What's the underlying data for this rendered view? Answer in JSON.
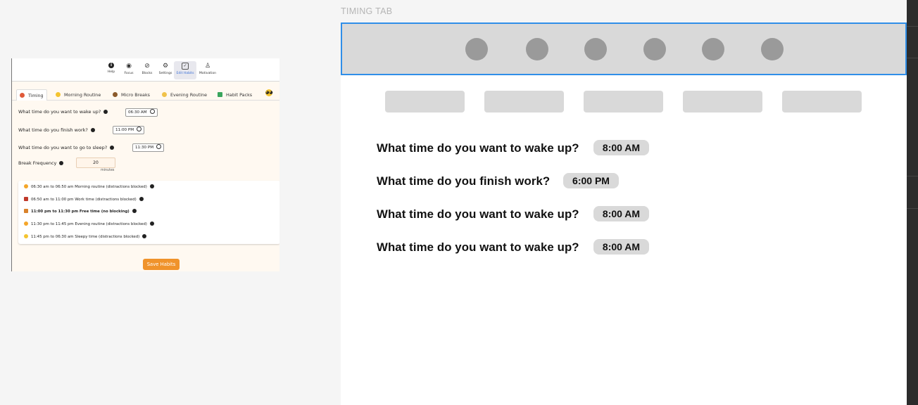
{
  "mini": {
    "nav": [
      {
        "label": "Help",
        "icon": "info-icon"
      },
      {
        "label": "Focus",
        "icon": "eye-icon"
      },
      {
        "label": "Blocks",
        "icon": "block-icon"
      },
      {
        "label": "Settings",
        "icon": "gear-icon"
      },
      {
        "label": "Edit Habits",
        "icon": "checkbox-icon"
      },
      {
        "label": "Motivation",
        "icon": "person-icon"
      }
    ],
    "tabs": [
      {
        "label": "Timing",
        "icon": "alarm-icon",
        "color": "#e05a3a"
      },
      {
        "label": "Morning Routine",
        "icon": "sun-icon",
        "color": "#f4c430"
      },
      {
        "label": "Micro Breaks",
        "icon": "coffee-icon",
        "color": "#8b5a2b"
      },
      {
        "label": "Evening Routine",
        "icon": "moon-icon",
        "color": "#f0c24a"
      },
      {
        "label": "Habit Packs",
        "icon": "books-icon",
        "color": "#3aa55d"
      }
    ],
    "questions": {
      "wake": "What time do you want to wake up?",
      "wake_time": "06:30 AM",
      "work": "What time do you finish work?",
      "work_time": "11:00 PM",
      "sleep": "What time do you want to go to sleep?",
      "sleep_time": "11:30 PM",
      "freq": "Break Frequency",
      "freq_value": "20",
      "freq_unit": "minutes"
    },
    "schedule": [
      {
        "text": "06:30 am to 06:50 am Morning routine (distractions blocked)",
        "emoji_color": "#f4a62a"
      },
      {
        "text": "06:50 am to 11:00 pm Work time (distractions blocked)",
        "emoji_color": "#c0392b"
      },
      {
        "text": "11:00 pm to 11:30 pm Free time (no blocking)",
        "emoji_color": "#d9822b"
      },
      {
        "text": "11:30 pm to 11:45 pm Evening routine (distractions blocked)",
        "emoji_color": "#f4a62a"
      },
      {
        "text": "11:45 pm to 06:30 am Sleepy time (distractions blocked)",
        "emoji_color": "#f4c430"
      }
    ],
    "save_label": "Save Habits"
  },
  "wireframe": {
    "title": "TIMING TAB",
    "questions": [
      {
        "q": "What time do you want to wake up?",
        "time": "8:00 AM"
      },
      {
        "q": "What time do you finish work?",
        "time": "6:00 PM"
      },
      {
        "q": "What time do you want to wake up?",
        "time": "8:00 AM"
      },
      {
        "q": "What time do you want to wake up?",
        "time": "8:00 AM"
      }
    ]
  },
  "colors": {
    "accent": "#2f8ee8",
    "save_button": "#f0932b",
    "placeholder": "#d9d9d9"
  }
}
